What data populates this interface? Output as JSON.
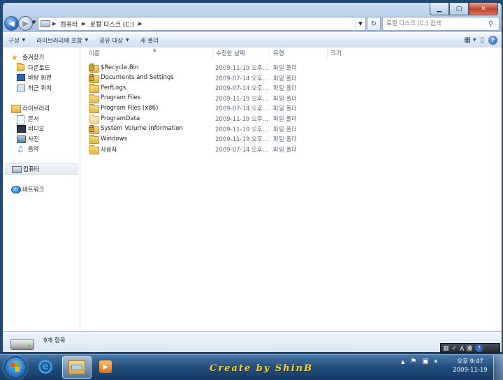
{
  "address": {
    "crumbs": [
      "컴퓨터",
      "로컬 디스크 (C:)"
    ]
  },
  "search": {
    "placeholder": "로컬 디스크 (C:) 검색"
  },
  "toolbar": {
    "organize": "구성",
    "include_library": "라이브러리에 포함",
    "share": "공유 대상",
    "new_folder": "새 폴더"
  },
  "nav": {
    "favorites": "즐겨찾기",
    "downloads": "다운로드",
    "desktop": "바탕 화면",
    "recent": "최근 위치",
    "libraries": "라이브러리",
    "documents": "문서",
    "videos": "비디오",
    "pictures": "사진",
    "music": "음악",
    "computer": "컴퓨터",
    "network": "네트워크"
  },
  "columns": {
    "name": "이름",
    "modified": "수정한 날짜",
    "type": "유형",
    "size": "크기"
  },
  "files": [
    {
      "name": "$Recycle.Bin",
      "date": "2009-11-19 오후...",
      "type": "파일 폴더",
      "locked": true,
      "light": false
    },
    {
      "name": "Documents and Settings",
      "date": "2009-07-14 오후...",
      "type": "파일 폴더",
      "locked": true,
      "light": false
    },
    {
      "name": "PerfLogs",
      "date": "2009-07-14 오후...",
      "type": "파일 폴더",
      "locked": false,
      "light": false
    },
    {
      "name": "Program Files",
      "date": "2009-11-19 오후...",
      "type": "파일 폴더",
      "locked": false,
      "light": false
    },
    {
      "name": "Program Files (x86)",
      "date": "2009-07-14 오후...",
      "type": "파일 폴더",
      "locked": false,
      "light": false
    },
    {
      "name": "ProgramData",
      "date": "2009-11-19 오후...",
      "type": "파일 폴더",
      "locked": false,
      "light": true
    },
    {
      "name": "System Volume Information",
      "date": "2009-11-19 오후...",
      "type": "파일 폴더",
      "locked": true,
      "light": false
    },
    {
      "name": "Windows",
      "date": "2009-11-19 오후...",
      "type": "파일 폴더",
      "locked": false,
      "light": false
    },
    {
      "name": "사용자",
      "date": "2009-07-14 오후...",
      "type": "파일 폴더",
      "locked": false,
      "light": false
    }
  ],
  "status": {
    "item_count": "9개 항목"
  },
  "taskbar": {
    "credit": "Create by ShinB",
    "time": "오후 9:47",
    "date": "2009-11-19"
  },
  "langbar": {
    "text": "A 漢"
  }
}
